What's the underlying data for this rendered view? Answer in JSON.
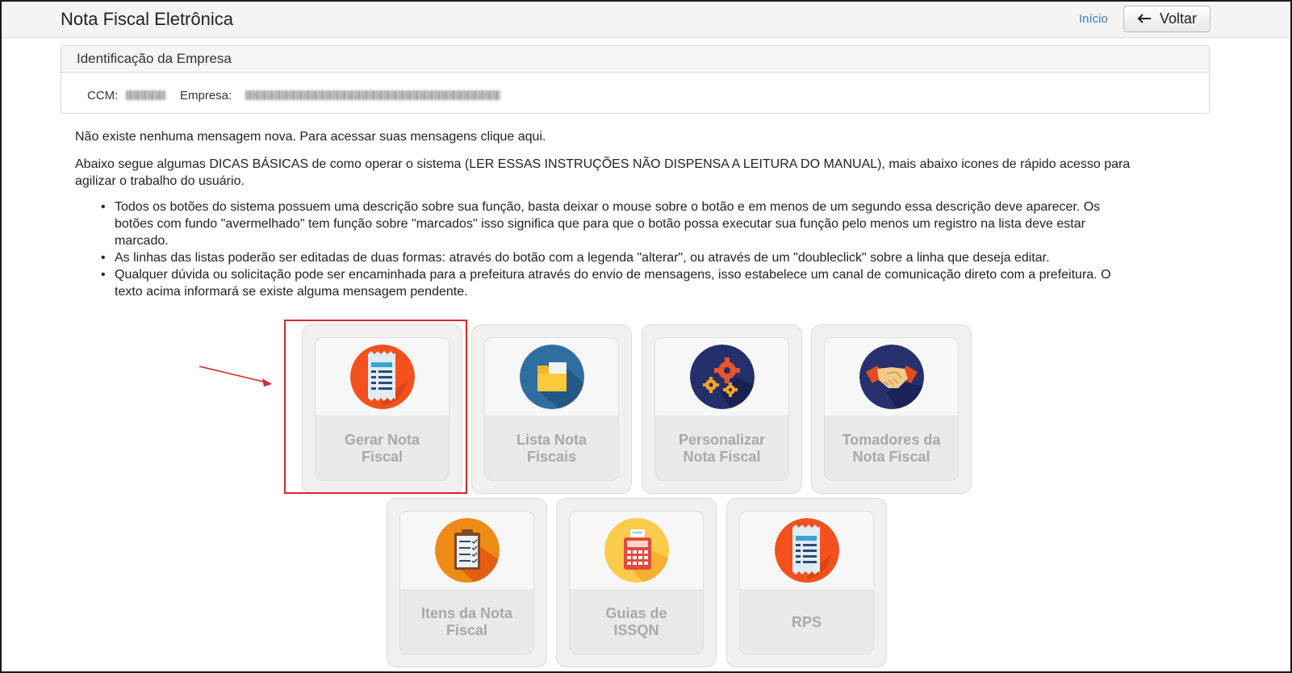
{
  "header": {
    "title": "Nota Fiscal Eletrônica",
    "home_link": "Início",
    "back_label": "Voltar",
    "back_icon": "arrow-left-icon"
  },
  "company_panel": {
    "title": "Identificação da Empresa",
    "ccm_label": "CCM:",
    "empresa_label": "Empresa:"
  },
  "messages": {
    "notice": "Não existe nenhuma mensagem nova. Para acessar suas mensagens clique aqui.",
    "tips_intro": "Abaixo segue algumas DICAS BÁSICAS de como operar o sistema (LER ESSAS INSTRUÇÕES NÃO DISPENSA A LEITURA DO MANUAL), mais abaixo icones de rápido acesso para agilizar o trabalho do usuário.",
    "tips": [
      "Todos os botões do sistema possuem uma descrição sobre sua função, basta deixar o mouse sobre o botão e em menos de um segundo essa descrição deve aparecer. Os botões com fundo \"avermelhado\" tem função sobre \"marcados\" isso significa que para que o botão possa executar sua função pelo menos um registro na lista deve estar marcado.",
      "As linhas das listas poderão ser editadas de duas formas: através do botão com a legenda \"alterar\", ou através de um \"doubleclick\" sobre a linha que deseja editar.",
      "Qualquer dúvida ou solicitação pode ser encaminhada para a prefeitura através do envio de mensagens, isso estabelece um canal de comunicação direto com a prefeitura. O texto acima informará se existe alguma mensagem pendente."
    ]
  },
  "tiles": [
    {
      "label": "Gerar Nota Fiscal",
      "icon": "receipt-icon",
      "color": "#f4511e"
    },
    {
      "label": "Lista Nota Fiscais",
      "icon": "folder-icon",
      "color": "#2f6fa0"
    },
    {
      "label": "Personalizar Nota Fiscal",
      "icon": "gears-icon",
      "color": "#24306b"
    },
    {
      "label": "Tomadores da Nota Fiscal",
      "icon": "handshake-icon",
      "color": "#26316e"
    },
    {
      "label": "Itens da Nota Fiscal",
      "icon": "clipboard-icon",
      "color": "#ee8a16"
    },
    {
      "label": "Guias de ISSQN",
      "icon": "calculator-icon",
      "color": "#fbcb4a"
    },
    {
      "label": "RPS",
      "icon": "receipt-icon",
      "color": "#f4511e"
    }
  ],
  "colors": {
    "link": "#3a7bbf",
    "highlight": "#d8262b",
    "tile_text": "#a8a8a8"
  }
}
